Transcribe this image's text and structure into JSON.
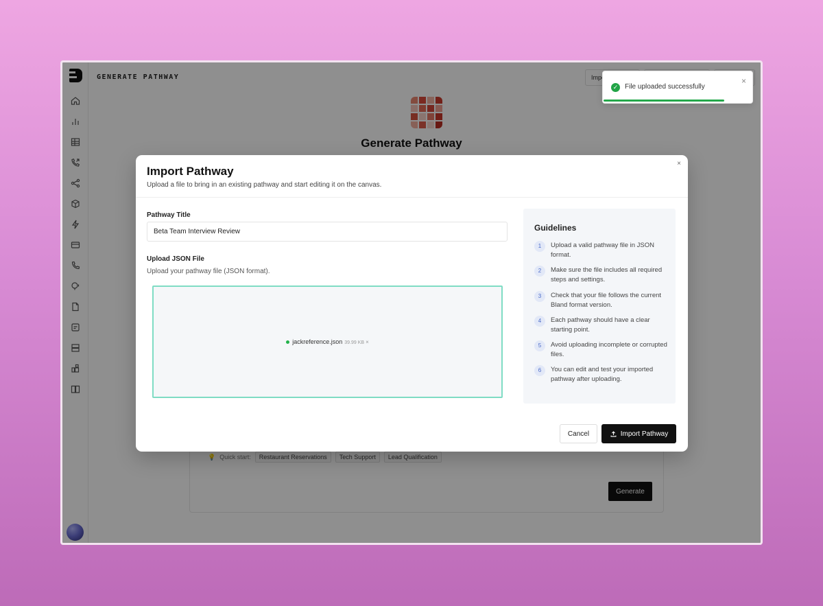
{
  "app": {
    "page_title": "GENERATE PATHWAY",
    "center_title": "Generate Pathway",
    "top_buttons": [
      "Impo"
    ]
  },
  "sidebar": {
    "items": [
      {
        "name": "home-icon"
      },
      {
        "name": "analytics-icon"
      },
      {
        "name": "table-icon"
      },
      {
        "name": "call-icon"
      },
      {
        "name": "share-icon"
      },
      {
        "name": "cube-icon"
      },
      {
        "name": "bolt-icon"
      },
      {
        "name": "card-icon"
      },
      {
        "name": "phone-icon"
      },
      {
        "name": "voice-icon"
      },
      {
        "name": "document-icon"
      },
      {
        "name": "note-icon"
      },
      {
        "name": "storage-icon"
      },
      {
        "name": "widgets-icon"
      },
      {
        "name": "book-icon"
      }
    ]
  },
  "background_card": {
    "quick_start_label": "Quick start:",
    "chips": [
      "Restaurant Reservations",
      "Tech Support",
      "Lead Qualification"
    ],
    "generate_label": "Generate"
  },
  "toast": {
    "message": "File uploaded successfully",
    "close": "×",
    "progress": 0.8
  },
  "modal": {
    "title": "Import Pathway",
    "subtitle": "Upload a file to bring in an existing pathway and start editing it on the canvas.",
    "close": "×",
    "pathway_title_label": "Pathway Title",
    "pathway_title_value": "Beta Team Interview Review",
    "upload_label": "Upload JSON File",
    "upload_description": "Upload your pathway file (JSON format).",
    "file_name": "jackreference.json",
    "file_size": "39.99 KB",
    "file_remove": "×",
    "guidelines_title": "Guidelines",
    "guidelines": [
      {
        "num": "1",
        "text": "Upload a valid pathway file in JSON format."
      },
      {
        "num": "2",
        "text": "Make sure the file includes all required steps and settings."
      },
      {
        "num": "3",
        "text": "Check that your file follows the current Bland format version."
      },
      {
        "num": "4",
        "text": "Each pathway should have a clear starting point."
      },
      {
        "num": "5",
        "text": "Avoid uploading incomplete or corrupted files."
      },
      {
        "num": "6",
        "text": "You can edit and test your imported pathway after uploading."
      }
    ],
    "cancel_label": "Cancel",
    "import_label": "Import Pathway"
  },
  "colors": {
    "accent": "#111111",
    "success": "#22a447",
    "dropzone_border": "#7fdcc4"
  }
}
